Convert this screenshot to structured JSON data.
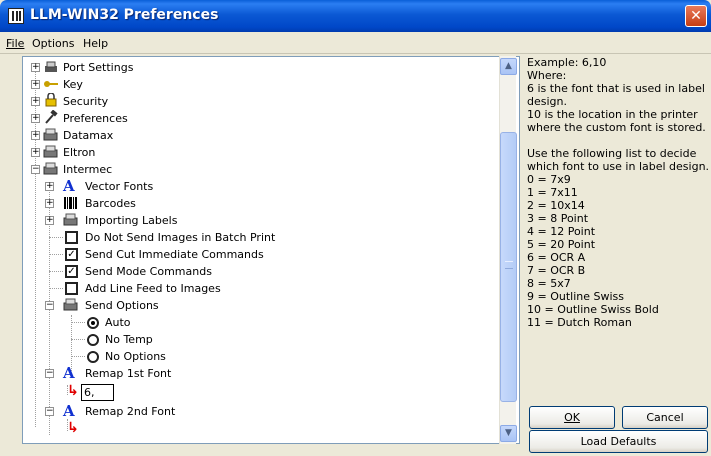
{
  "window": {
    "title": "LLM-WIN32 Preferences",
    "close_glyph": "✕"
  },
  "menu": {
    "file": "File",
    "options": "Options",
    "help": "Help"
  },
  "tree": {
    "port_settings": "Port Settings",
    "key": "Key",
    "security": "Security",
    "preferences": "Preferences",
    "datamax": "Datamax",
    "eltron": "Eltron",
    "intermec": "Intermec",
    "vector_fonts": "Vector Fonts",
    "barcodes": "Barcodes",
    "importing_labels": "Importing Labels",
    "do_not_send_images": "Do Not Send Images in Batch Print",
    "send_cut_immediate": "Send Cut Immediate Commands",
    "send_mode_commands": "Send Mode Commands",
    "add_line_feed": "Add Line Feed to Images",
    "send_options": "Send Options",
    "auto": "Auto",
    "no_temp": "No Temp",
    "no_options": "No Options",
    "remap_1st_font": "Remap 1st Font",
    "remap_1st_value": "6,",
    "remap_2nd_font": "Remap 2nd Font"
  },
  "help": {
    "line1": "Example: 6,10",
    "line2": "Where:",
    "line3": "6 is the font that is used in label",
    "line4": "design.",
    "line5": "10 is the location in the printer",
    "line6": "where the custom font is stored.",
    "line7": "Use the following list to decide",
    "line8": "which font to use in label design.",
    "fonts": [
      "0 = 7x9",
      "1 = 7x11",
      "2 = 10x14",
      "3 = 8 Point",
      "4 = 12 Point",
      "5 = 20 Point",
      "6 = OCR A",
      "7 = OCR B",
      "8 = 5x7",
      "9 = Outline Swiss",
      "10 = Outline Swiss Bold",
      "11 = Dutch Roman"
    ]
  },
  "buttons": {
    "ok": "OK",
    "cancel": "Cancel",
    "load_defaults": "Load Defaults"
  },
  "colors": {
    "titlebar": "#0047c8",
    "accent_red": "#e00000",
    "vector_blue": "#1030d0"
  },
  "icons": [
    "printer-icon",
    "key-icon",
    "lock-icon",
    "hammer-icon",
    "printer-icon",
    "printer-icon",
    "printer-icon",
    "vector-font-icon",
    "barcode-icon",
    "printer-icon",
    "printer-icon",
    "remap-arrow-icon"
  ]
}
